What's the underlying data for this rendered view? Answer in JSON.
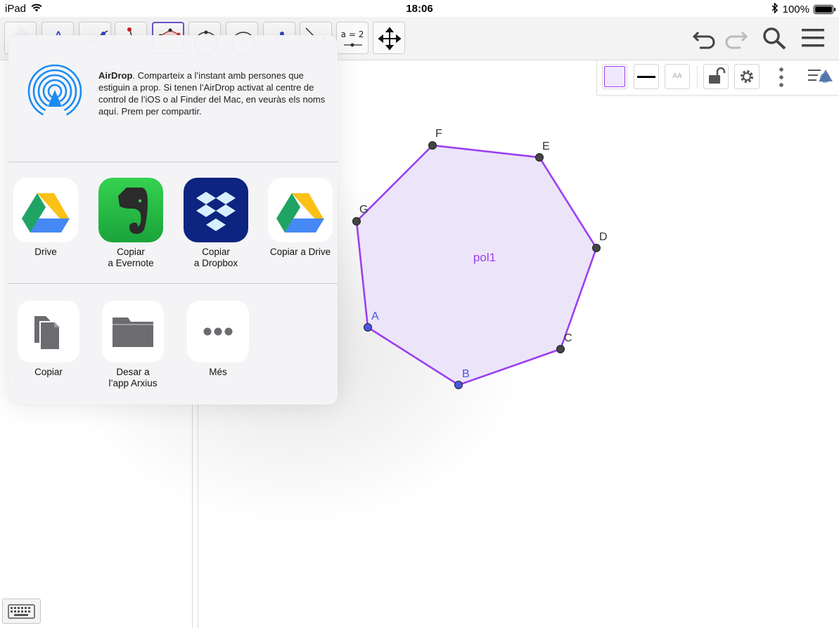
{
  "status_bar": {
    "device": "iPad",
    "time": "18:06",
    "battery": "100%",
    "icons": [
      "wifi-icon",
      "bluetooth-icon",
      "battery-icon"
    ]
  },
  "toolbar": {
    "tools": [
      "text-tool-icon",
      "point-on-line-tool-icon",
      "perpendicular-tool-icon",
      "polygon-tool-icon",
      "circle-two-points-tool-icon",
      "circle-center-point-tool-icon",
      "point-tool-icon",
      "line-tool-icon",
      "slider-tool-icon",
      "move-graphics-tool-icon"
    ],
    "slider_tool_text": "a = 2",
    "right_icons": [
      "undo-icon",
      "redo-icon",
      "search-icon",
      "menu-icon"
    ]
  },
  "style_bar": {
    "buttons": [
      "fill-color-button",
      "line-style-button",
      "label-style-button",
      "lock-button",
      "settings-button",
      "more-button",
      "toggle-style-bar-button"
    ],
    "label_text": "AA",
    "fill_color": "#efe9fb",
    "line_color": "#000000"
  },
  "share_sheet": {
    "airdrop": {
      "title": "AirDrop",
      "text": ". Comparteix a l’instant amb persones que estiguin a prop. Si tenen l’AirDrop activat al centre de control de l’iOS o al Finder del Mac, en veuràs els noms aquí. Prem per compartir."
    },
    "apps": [
      {
        "label": "Drive",
        "icon": "google-drive-icon"
      },
      {
        "label": "Copiar\na Evernote",
        "icon": "evernote-icon"
      },
      {
        "label": "Copiar\na Dropbox",
        "icon": "dropbox-icon"
      },
      {
        "label": "Copiar a Drive",
        "icon": "google-drive-icon"
      }
    ],
    "actions": [
      {
        "label": "Copiar",
        "icon": "copy-icon"
      },
      {
        "label": "Desar a\nl’app Arxius",
        "icon": "folder-icon"
      },
      {
        "label": "Més",
        "icon": "more-dots-icon"
      }
    ]
  },
  "graphics": {
    "polygon_label": "pol1",
    "polygon_color": "#9b3ff0",
    "polygon_fill": "#ece5fa",
    "free_point_color": "#4a55e8",
    "dependent_point_color": "#444444",
    "points": [
      {
        "name": "A",
        "free": true
      },
      {
        "name": "B",
        "free": true
      },
      {
        "name": "C",
        "free": false
      },
      {
        "name": "D",
        "free": false
      },
      {
        "name": "E",
        "free": false
      },
      {
        "name": "F",
        "free": false
      },
      {
        "name": "G",
        "free": false
      }
    ]
  }
}
